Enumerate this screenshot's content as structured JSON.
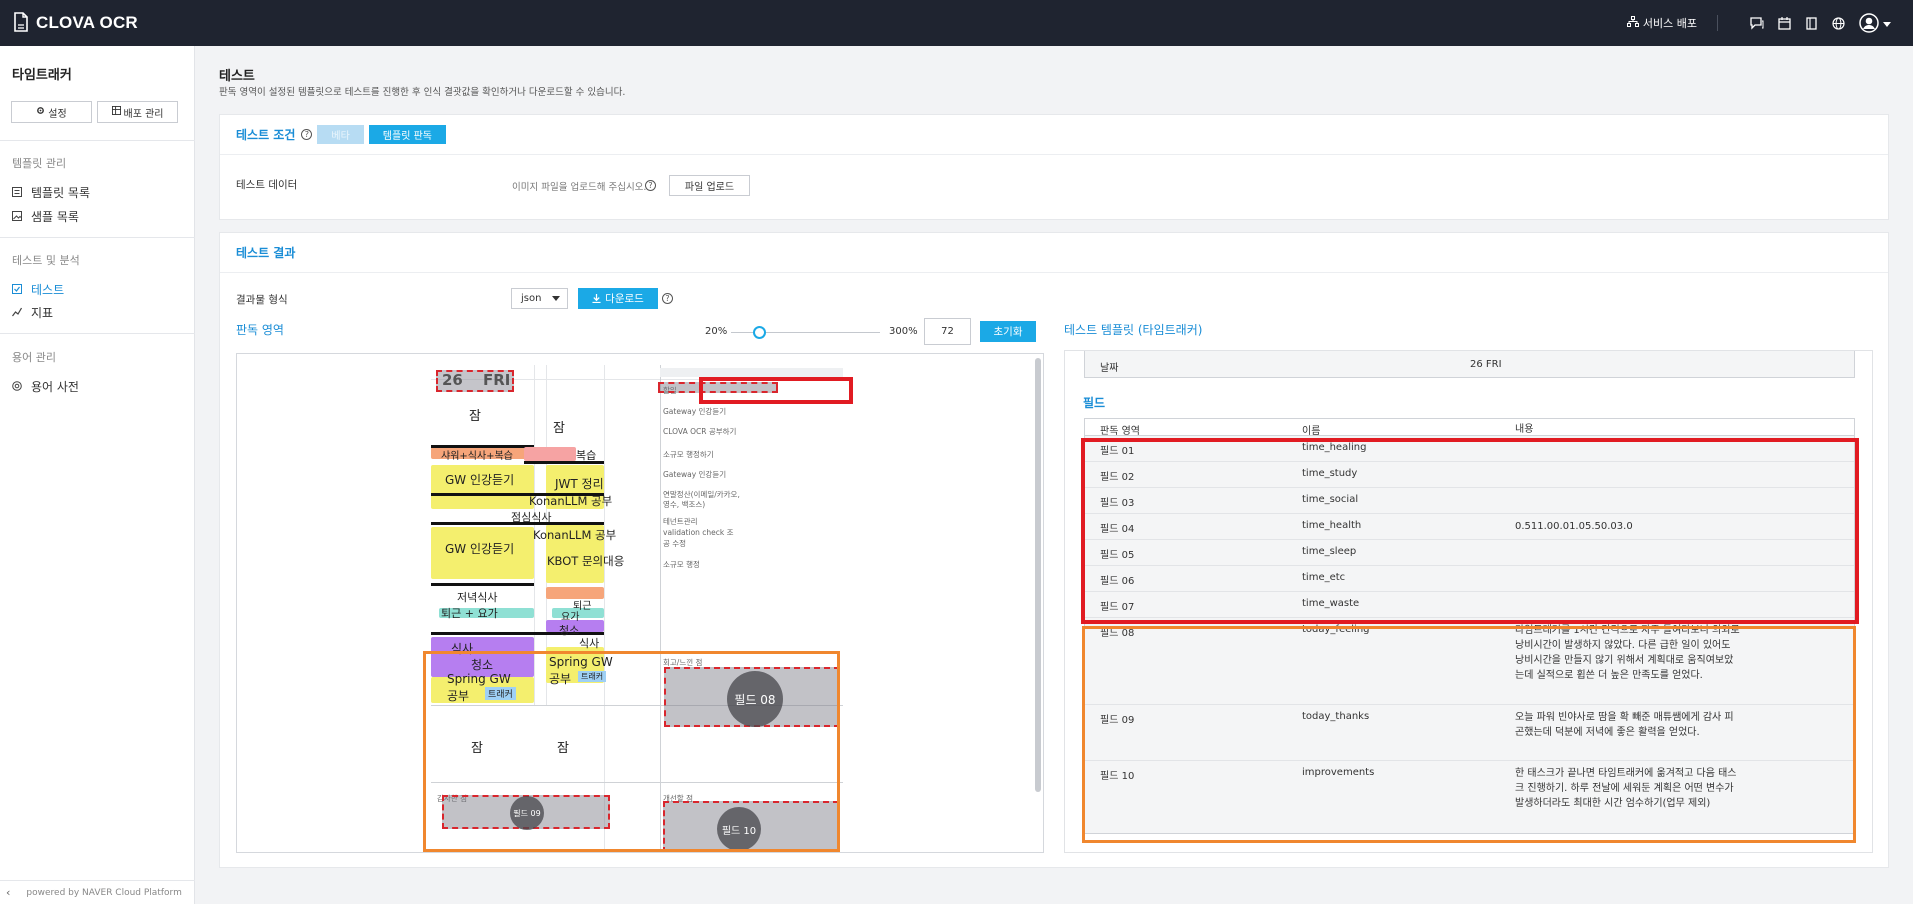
{
  "app": {
    "title": "CLOVA OCR"
  },
  "topbar": {
    "deploy_label": "서비스 배포"
  },
  "sidebar": {
    "project_title": "타임트래커",
    "settings_label": "설정",
    "deploy_mgmt_label": "배포 관리",
    "group_template": "템플릿 관리",
    "item_template_list": "템플릿 목록",
    "item_sample_list": "샘플 목록",
    "group_test": "테스트 및 분석",
    "item_test": "테스트",
    "item_metrics": "지표",
    "group_terms": "용어 관리",
    "item_dictionary": "용어 사전",
    "footer": "powered by NAVER Cloud Platform"
  },
  "page": {
    "title": "테스트",
    "description": "판독 영역이 설정된 템플릿으로 테스트를 진행한 후 인식 결괏값을 확인하거나 다운로드할 수 있습니다."
  },
  "conditions": {
    "title": "테스트 조건",
    "beta_label": "베타",
    "template_read_label": "템플릿 판독",
    "test_data_label": "테스트 데이터",
    "upload_hint": "이미지 파일을 업로드해 주십시오.",
    "upload_button": "파일 업로드"
  },
  "results": {
    "title": "테스트 결과",
    "format_label": "결과물 형식",
    "format_value": "json",
    "download_button": "다운로드",
    "read_area_title": "판독 영역",
    "zoom_min": "20%",
    "zoom_max": "300%",
    "zoom_value": "72",
    "zoom_level_pct": 72,
    "reset_button": "초기화",
    "template_title": "테스트 템플릿 (타임트래커)",
    "date_label": "날짜",
    "date_value": "26 FRI",
    "fields_title": "필드",
    "col_area": "판독 영역",
    "col_name": "이름",
    "col_content": "내용",
    "rows": [
      {
        "area": "필드 01",
        "name": "time_healing",
        "content": ""
      },
      {
        "area": "필드 02",
        "name": "time_study",
        "content": ""
      },
      {
        "area": "필드 03",
        "name": "time_social",
        "content": ""
      },
      {
        "area": "필드 04",
        "name": "time_health",
        "content": "0.511.00.01.05.50.03.0"
      },
      {
        "area": "필드 05",
        "name": "time_sleep",
        "content": ""
      },
      {
        "area": "필드 06",
        "name": "time_etc",
        "content": ""
      },
      {
        "area": "필드 07",
        "name": "time_waste",
        "content": ""
      },
      {
        "area": "필드 08",
        "name": "today_feeling",
        "content": "타임트래커를 1시간 간격으로 자주 들여다보니 의외로 낭비시간이 발생하지 않았다. 다른 급한 일이 있어도 낭비시간을 만들지 않기 위해서 계획대로 움직여보았는데 실적으로 휩쓴 더 높은 만족도를 얻었다."
      },
      {
        "area": "필드 09",
        "name": "today_thanks",
        "content": "오늘 파워 빈야사로 땀을 확 빼준 매튜쌤에게 감사 피곤했는데 덕분에 저녁에 좋은 활력을 얻었다."
      },
      {
        "area": "필드 10",
        "name": "improvements",
        "content": "한 태스크가 끝나면 타임트래커에 옮겨적고 다음 태스크 진행하기. 하루 전날에 세워둔 계획은 어떤 변수가 발생하더라도 최대한 시간 엄수하기(업무 제외)"
      }
    ]
  },
  "document": {
    "date_num": "26",
    "date_day": "FRI",
    "col_left": [
      {
        "text": "잠"
      },
      {
        "text": "샤워+식사+복습"
      },
      {
        "text": "GW 인강듣기"
      },
      {
        "text": "점심식사"
      },
      {
        "text": "GW 인강듣기"
      },
      {
        "text": "저녁식사"
      },
      {
        "text": "퇴근 + 요가"
      },
      {
        "text": "식사"
      },
      {
        "text": "청소"
      },
      {
        "text": "Spring GW"
      },
      {
        "text": "공부"
      },
      {
        "text": "트래커"
      },
      {
        "text": "잠"
      }
    ],
    "col_mid": [
      {
        "text": "잠"
      },
      {
        "text": "복습"
      },
      {
        "text": "JWT 정리"
      },
      {
        "text": "KonanLLM 공부"
      },
      {
        "text": "KonanLLM 공부"
      },
      {
        "text": "KBOT 문의대응"
      },
      {
        "text": "퇴근"
      },
      {
        "text": "요가"
      },
      {
        "text": "청소"
      },
      {
        "text": "식사"
      },
      {
        "text": "Spring GW"
      },
      {
        "text": "공부"
      },
      {
        "text": "트래커"
      },
      {
        "text": "잠"
      }
    ],
    "notes": [
      "할일",
      "Gateway 인강듣기",
      "CLOVA OCR 공부하기",
      "소규모 행정하기",
      "Gateway 인강듣기",
      "연말정산(이메일/카카오,",
      "영수, 백조스)",
      "테넌트관리",
      "validation check 조",
      "공 수정",
      "소규모 행정",
      "회고/느낀 점",
      "감사한 점",
      "개선할 점"
    ],
    "badge_08": "필드 08",
    "badge_09": "필드 09",
    "badge_10": "필드 10"
  },
  "colors": {
    "accent": "#1ba9e6",
    "link": "#1a8dd6",
    "topbar": "#1f2430",
    "red_highlight": "#e11b22",
    "orange_highlight": "#f0872e"
  }
}
